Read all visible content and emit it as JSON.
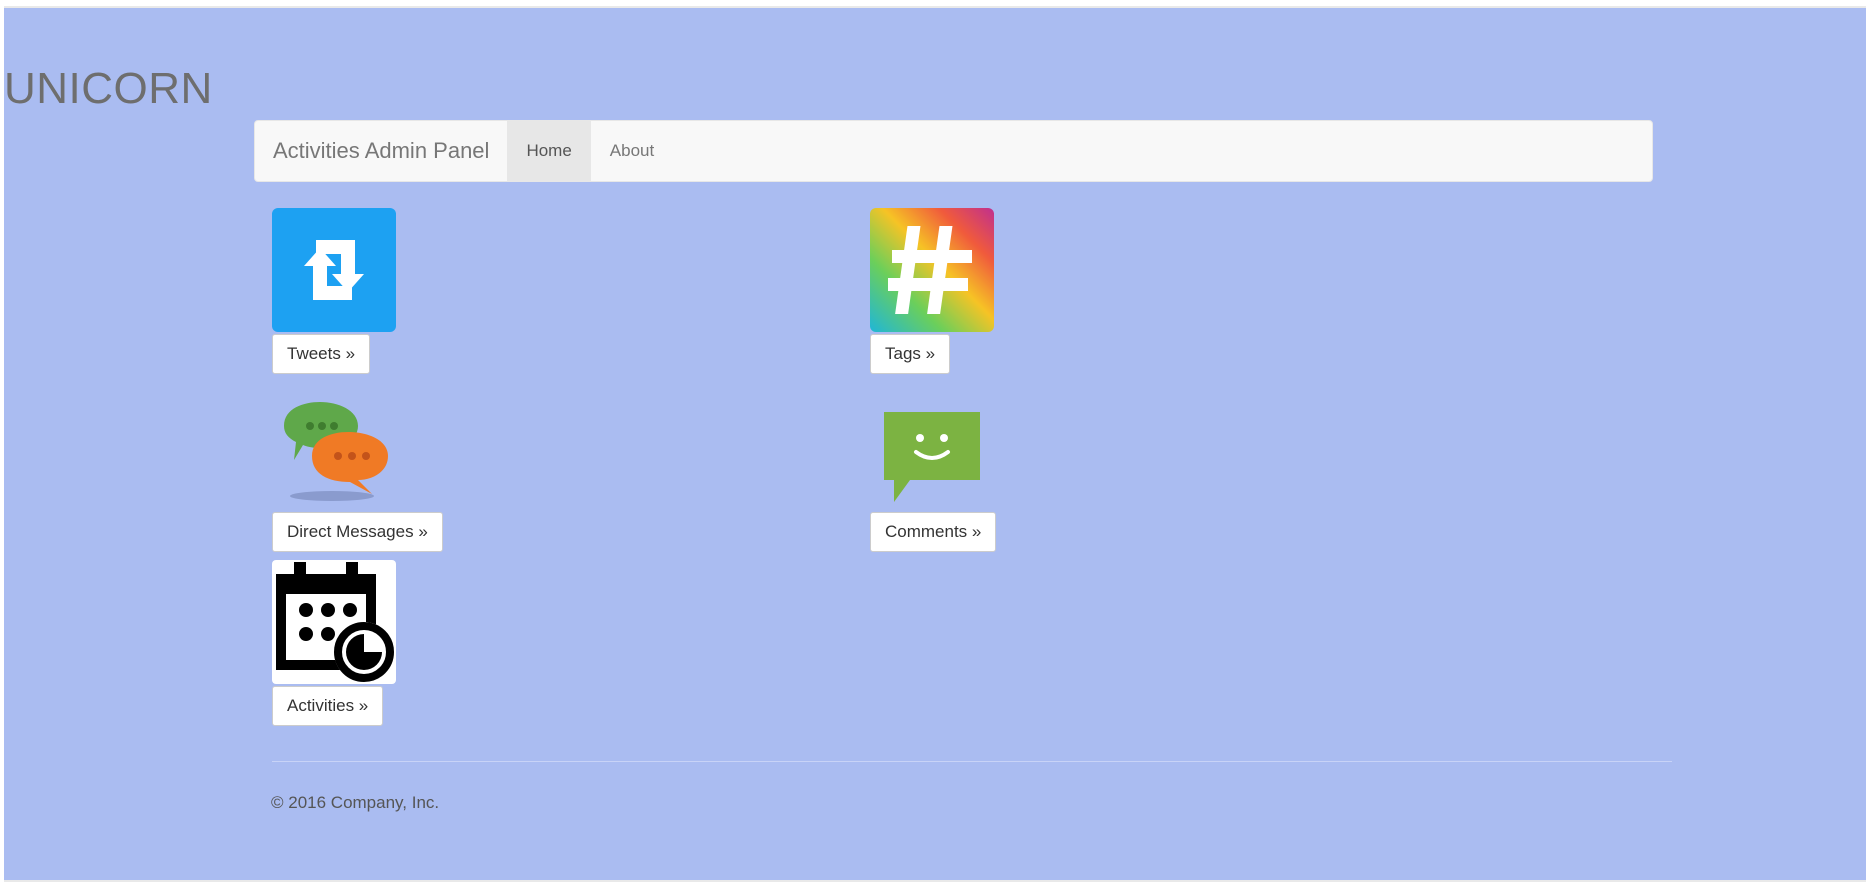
{
  "app": {
    "title": "UNICORN"
  },
  "navbar": {
    "brand": "Activities Admin Panel",
    "items": [
      {
        "label": "Home",
        "active": true
      },
      {
        "label": "About",
        "active": false
      }
    ]
  },
  "tiles": [
    {
      "id": "tweets",
      "label": "Tweets »",
      "icon": "retweet-icon",
      "color": "#1da1f2"
    },
    {
      "id": "tags",
      "label": "Tags »",
      "icon": "hashtag-icon"
    },
    {
      "id": "direct-messages",
      "label": "Direct Messages »",
      "icon": "chat-bubbles-icon"
    },
    {
      "id": "comments",
      "label": "Comments »",
      "icon": "smiley-comment-icon",
      "color": "#7cb342"
    },
    {
      "id": "activities",
      "label": "Activities »",
      "icon": "calendar-clock-icon"
    }
  ],
  "footer": {
    "text": "© 2016 Company, Inc."
  },
  "colors": {
    "page_background": "#aabcf1",
    "navbar_background": "#f8f8f8"
  }
}
